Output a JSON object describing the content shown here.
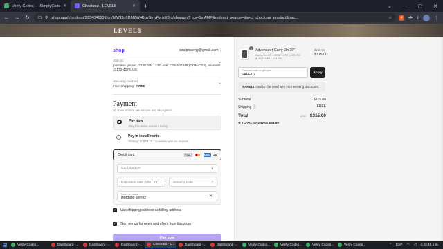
{
  "browser": {
    "tabs": [
      {
        "label": "Verify Codes — SimplyCodes",
        "active": false
      },
      {
        "label": "Checkout - LEVEL8",
        "active": true
      }
    ],
    "new_tab": "+",
    "url": "shop.app/checkout/2934046831/cn/hWN2u6DMZW4BgvSmyFynkE3m/shoppay?_cs=3s.AMP&redirect_source=direct_checkout_product&trac...",
    "extension_badge": "4"
  },
  "banner": {
    "brand": "LEVEL8"
  },
  "contact": {
    "shop_logo": "shop",
    "email": "soulpowerjg@gmail.com"
  },
  "ship_to": {
    "label": "Ship to",
    "value": "jhordano gomez, 2240 NW 114th Ave, C26-507449 (DOM-C23), Miami FL 33172-4179, US"
  },
  "shipping_method": {
    "label": "Shipping method",
    "value": "Free Shipping",
    "price": "FREE"
  },
  "payment": {
    "heading": "Payment",
    "subtitle": "All transactions are secure and encrypted.",
    "options": [
      {
        "title": "Pay now",
        "desc": "Pay the entire amount today",
        "selected": true
      },
      {
        "title": "Pay in installments",
        "desc": "Starting at $78.75 / 2-weeks with no interest",
        "selected": false
      }
    ],
    "credit_card": {
      "label": "Credit card",
      "card_logos": [
        "VISA",
        "MC",
        "AMEX"
      ],
      "more": "+5",
      "card_number_placeholder": "Card number",
      "expiration_placeholder": "Expiration date (MM / YY)",
      "security_placeholder": "Security code",
      "name_label": "Name on card",
      "name_value": "jhordano gomez"
    },
    "billing_checkbox": "Use shipping address as billing address",
    "news_checkbox": "Sign me up for news and offers from this store",
    "pay_button": "Pay now"
  },
  "order": {
    "item": {
      "quantity": "1",
      "name": "Adventurer Carry-On 20\"",
      "variant": "Carry-On 20\" / GRAPHITE_LIMITED",
      "discount": "AUTUMN (-$34.99)",
      "compare_price": "$349.99",
      "price": "$315.00"
    },
    "discount_label": "Discount code or gift card",
    "discount_value": "SAFE10",
    "apply_button": "Apply",
    "error_code": "SAFE10",
    "error_text": "couldn't be used with your existing discounts.",
    "subtotal_label": "Subtotal",
    "subtotal_value": "$315.00",
    "shipping_label": "Shipping",
    "shipping_value": "FREE",
    "total_label": "Total",
    "total_currency": "USD",
    "total_value": "$315.00",
    "savings_label": "TOTAL SAVINGS",
    "savings_value": "$34.99"
  },
  "taskbar": {
    "items": [
      {
        "label": "Verify Codes...",
        "size": "w57",
        "active": false
      },
      {
        "label": "Dashboard -...",
        "size": "w45",
        "active": false
      },
      {
        "label": "Dashboard -...",
        "size": "w45",
        "active": false
      },
      {
        "label": "Dashboard -...",
        "size": "w45",
        "active": false
      },
      {
        "label": "Checkout - L...",
        "size": "w45",
        "active": true
      },
      {
        "label": "Dashboard -...",
        "size": "w45",
        "active": false
      },
      {
        "label": "Dashboard -...",
        "size": "w45",
        "active": false
      },
      {
        "label": "Verify Codes...",
        "size": "w45",
        "active": false
      },
      {
        "label": "Verify Codes...",
        "size": "w45",
        "active": false
      },
      {
        "label": "Verify Codes...",
        "size": "w45",
        "active": false
      },
      {
        "label": "Verify Codes...",
        "size": "w45",
        "active": false
      }
    ],
    "lang": "ESP",
    "clock": "4:43:49 p.m."
  }
}
